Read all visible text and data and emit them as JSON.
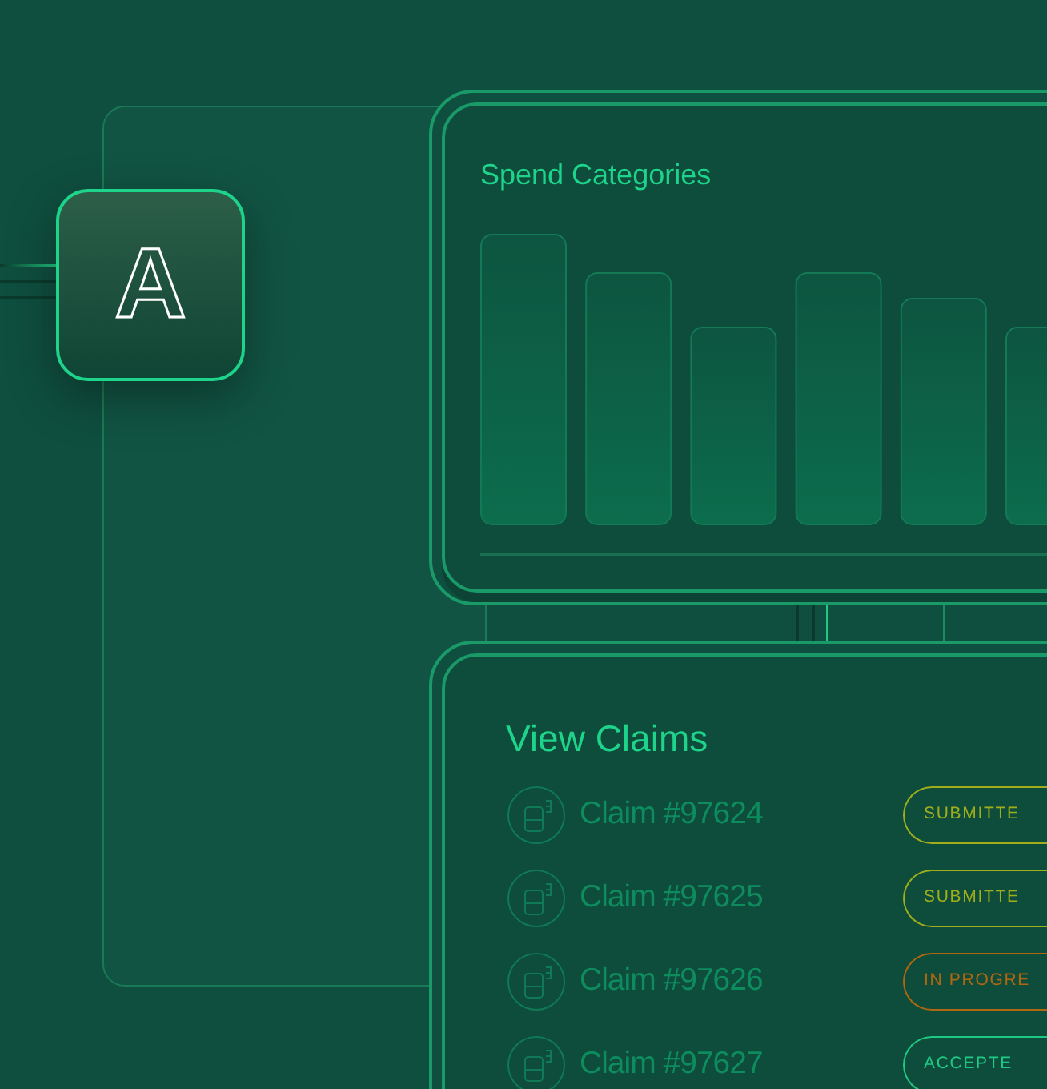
{
  "logo": {
    "letter": "A"
  },
  "spend_card": {
    "title": "Spend Categories"
  },
  "claims_card": {
    "title": "View Claims",
    "claims": [
      {
        "label": "Claim #97624",
        "status": "SUBMITTE",
        "color": "#9fae1a"
      },
      {
        "label": "Claim #97625",
        "status": "SUBMITTE",
        "color": "#9fae1a"
      },
      {
        "label": "Claim #97626",
        "status": "IN PROGRE",
        "color": "#b0670f"
      },
      {
        "label": "Claim #97627",
        "status": "ACCEPTE",
        "color": "#1ec983"
      }
    ]
  }
}
